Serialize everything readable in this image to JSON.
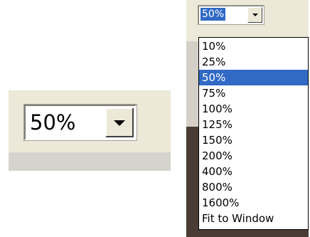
{
  "zoom_collapsed": {
    "value": "50%",
    "dropdown_icon": "chevron-down-icon"
  },
  "zoom_expanded": {
    "value": "50%",
    "dropdown_icon": "chevron-down-icon",
    "options": [
      "10%",
      "25%",
      "50%",
      "75%",
      "100%",
      "125%",
      "150%",
      "200%",
      "400%",
      "800%",
      "1600%",
      "Fit to Window"
    ],
    "selected_option": "50%"
  },
  "colors": {
    "selection": "#316ac5",
    "toolbar": "#ece9d8"
  }
}
